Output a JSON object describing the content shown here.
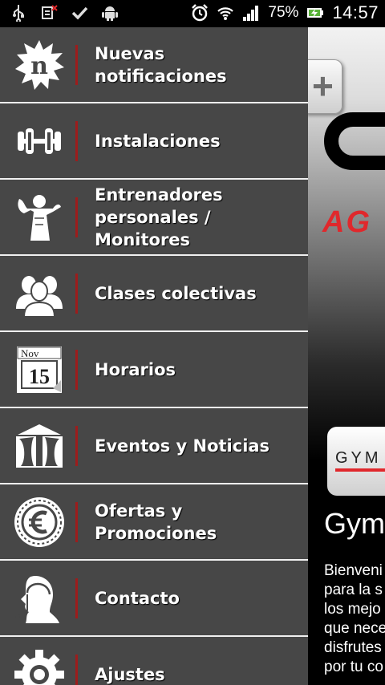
{
  "status_bar": {
    "battery_percent": "75%",
    "time": "14:57",
    "icons": [
      "usb-icon",
      "sim-icon",
      "check-icon",
      "android-icon",
      "alarm-icon",
      "wifi-icon",
      "signal-icon",
      "battery-charging-icon"
    ]
  },
  "menu": {
    "items": [
      {
        "label": "Nuevas notificaciones",
        "icon": "notification-badge-icon"
      },
      {
        "label": "Instalaciones",
        "icon": "dumbbell-icon"
      },
      {
        "label": "Entrenadores personales / Monitores",
        "icon": "bodybuilder-icon"
      },
      {
        "label": "Clases colectivas",
        "icon": "group-people-icon"
      },
      {
        "label": "Horarios",
        "icon": "calendar-icon"
      },
      {
        "label": "Eventos y Noticias",
        "icon": "tent-icon"
      },
      {
        "label": "Ofertas y Promociones",
        "icon": "euro-coin-icon"
      },
      {
        "label": "Contacto",
        "icon": "headset-person-icon"
      },
      {
        "label": "Ajustes",
        "icon": "gear-icon"
      }
    ],
    "calendar_month": "Nov",
    "calendar_day": "15",
    "badge_letter": "n"
  },
  "background_page": {
    "thumb_text": "GYM",
    "title": "Gym",
    "body_lines": "Bienveni\npara la s\nlos mejo\nque nece\ndisfrutes\npor tu co",
    "plus_label": "+",
    "logo_red_text": "AG"
  },
  "colors": {
    "drawer_bg": "#474747",
    "separator": "#9c1c1c",
    "divider": "#f0f0f0",
    "accent_red": "#e0282c"
  }
}
